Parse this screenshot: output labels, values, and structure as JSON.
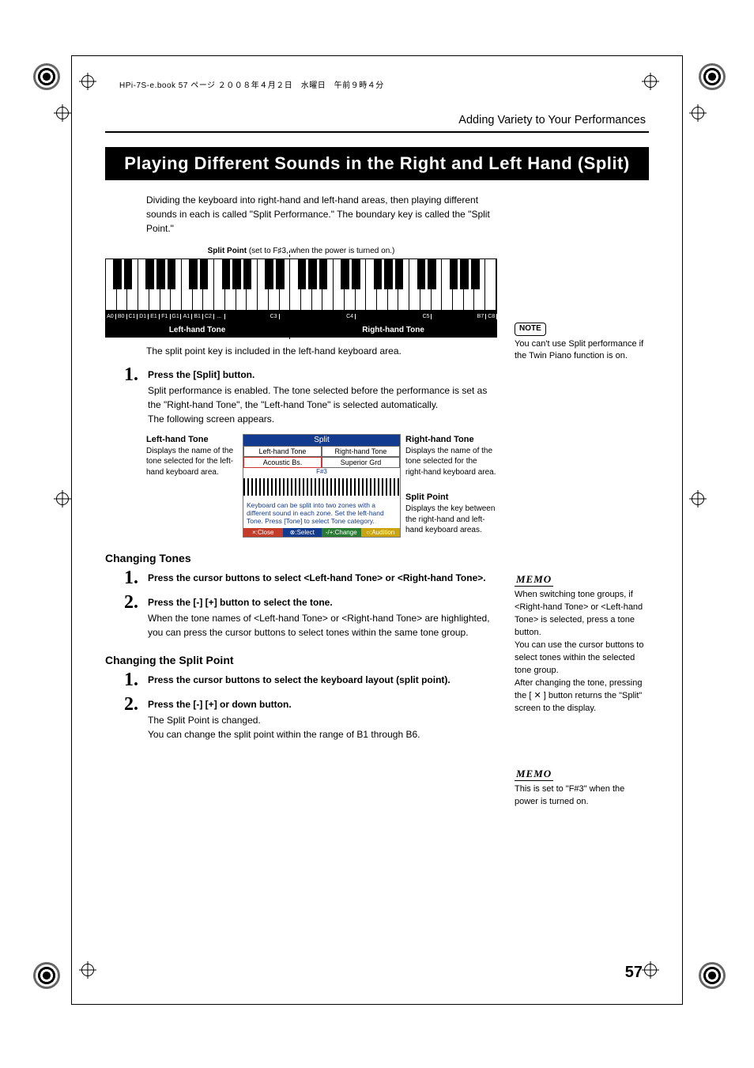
{
  "bookline": "HPi-7S-e.book  57 ページ  ２００８年４月２日　水曜日　午前９時４分",
  "running_head": "Adding Variety to Your Performances",
  "banner": "Playing Different Sounds in the Right and Left Hand (Split)",
  "intro": "Dividing the keyboard into right-hand and left-hand areas, then playing different sounds in each is called \"Split Performance.\" The boundary key is called the \"Split Point.\"",
  "kbd": {
    "split_caption_b": "Split Point",
    "split_caption": " (set to F♯3, when the power is turned on.)",
    "labels": [
      "A0",
      "B0",
      "C1",
      "D1",
      "E1",
      "F1",
      "G1",
      "A1",
      "B1",
      "C2",
      "...",
      "",
      "",
      "",
      "",
      "C3",
      "",
      "",
      "",
      "",
      "",
      "",
      "C4",
      "",
      "",
      "",
      "",
      "",
      "",
      "C5",
      "",
      "",
      "",
      "",
      "B7",
      "C8"
    ],
    "left_tone": "Left-hand Tone",
    "right_tone": "Right-hand Tone"
  },
  "after_kbd": "The split point key is included in the left-hand keyboard area.",
  "step1": {
    "n": "1.",
    "title": "Press the [Split] button.",
    "body1": "Split performance is enabled. The tone selected before the performance is set as the \"Right-hand Tone\", the \"Left-hand Tone\" is selected automatically.",
    "body2": "The following screen appears."
  },
  "tone_diagram": {
    "left_h": "Left-hand Tone",
    "left_t": "Displays the name of the tone selected for the left-hand keyboard area.",
    "right_h": "Right-hand Tone",
    "right_t": "Displays the name of the tone selected for the right-hand keyboard area.",
    "sp_h": "Split Point",
    "sp_t": "Displays the key between the right-hand and left-hand keyboard areas.",
    "screen": {
      "title": "Split",
      "row1a": "Left-hand Tone",
      "row1b": "Right-hand Tone",
      "row2a": "Acoustic Bs.",
      "row2b": "Superior Grd",
      "mini_label": "F#3",
      "msg": "Keyboard can be split into two zones with a different sound in each zone. Set the left-hand Tone. Press [Tone] to select Tone category.",
      "foot": [
        "×:Close",
        "⊗:Select",
        "-/+:Change",
        "○:Audition"
      ],
      "foot_colors": [
        "#c43b2a",
        "#123a8f",
        "#2a7a33",
        "#c9a40f"
      ]
    }
  },
  "changing_tones": {
    "h": "Changing Tones",
    "s1": {
      "n": "1.",
      "title": "Press the cursor buttons to select <Left-hand Tone> or <Right-hand Tone>."
    },
    "s2": {
      "n": "2.",
      "title": "Press the [-] [+] button to select the tone.",
      "body": "When the tone names of <Left-hand Tone> or <Right-hand Tone> are highlighted, you can press the cursor buttons to select tones within the same tone group."
    }
  },
  "changing_split": {
    "h": "Changing the Split Point",
    "s1": {
      "n": "1.",
      "title": "Press the cursor buttons to select the keyboard layout (split point)."
    },
    "s2": {
      "n": "2.",
      "title": "Press the [-] [+] or down button.",
      "body1": "The Split Point is changed.",
      "body2": "You can change the split point within the range of B1 through B6."
    }
  },
  "side": {
    "note_label": "NOTE",
    "note_text": "You can't use Split performance if the Twin Piano function is on.",
    "memo_label": "MEMO",
    "memo1": "When switching tone groups, if <Right-hand Tone> or <Left-hand Tone> is selected, press a tone button.\nYou can use the cursor buttons to select tones within the selected tone group.\nAfter changing the tone, pressing the [ ✕ ] button returns the \"Split\" screen to the display.",
    "memo2": "This is set to \"F#3\" when the power is turned on."
  },
  "page_number": "57"
}
